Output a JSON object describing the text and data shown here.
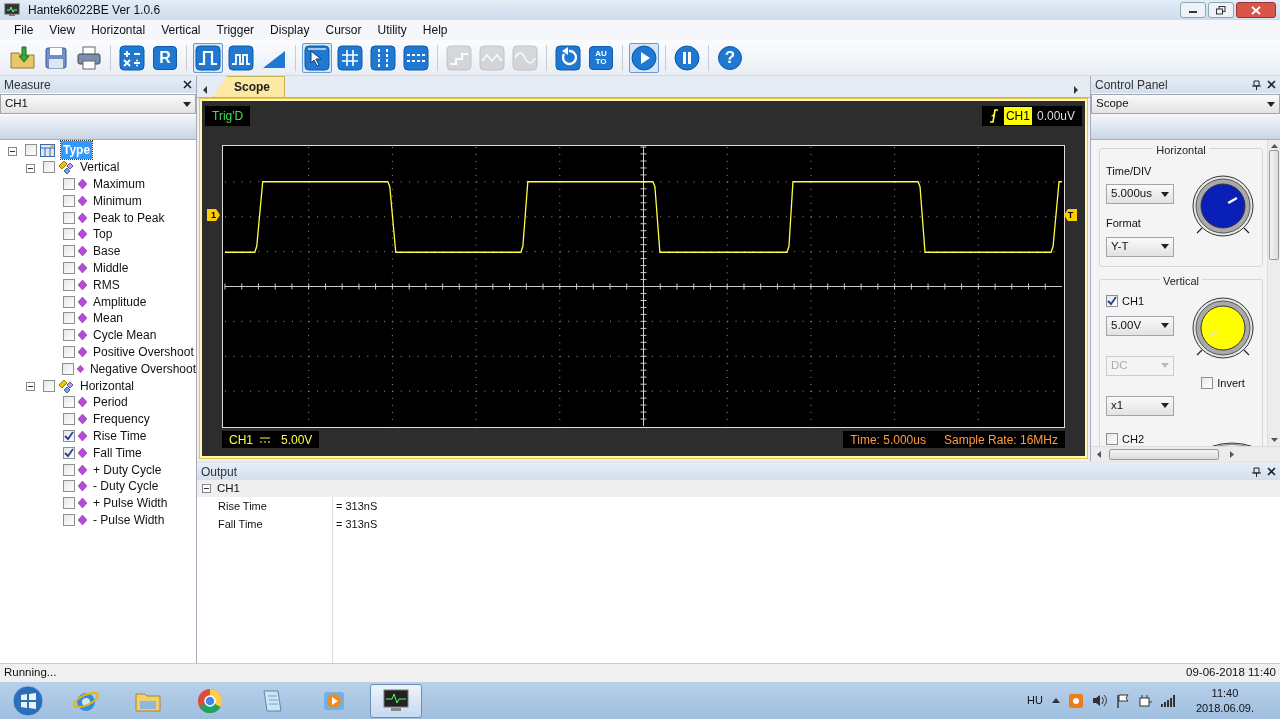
{
  "window": {
    "title": "Hantek6022BE Ver 1.0.6"
  },
  "menu": [
    "File",
    "View",
    "Horizontal",
    "Vertical",
    "Trigger",
    "Display",
    "Cursor",
    "Utility",
    "Help"
  ],
  "toolbar": [
    {
      "kind": "open",
      "selected": false,
      "disabled": false
    },
    {
      "kind": "save",
      "selected": false,
      "disabled": false
    },
    {
      "kind": "print",
      "selected": false,
      "disabled": false
    },
    {
      "kind": "math",
      "selected": false,
      "disabled": false
    },
    {
      "kind": "letter",
      "label": "R",
      "selected": false,
      "disabled": false
    },
    {
      "kind": "square",
      "selected": true,
      "disabled": false
    },
    {
      "kind": "pulse",
      "selected": false,
      "disabled": false
    },
    {
      "kind": "ramp",
      "selected": false,
      "disabled": false
    },
    {
      "kind": "pointer",
      "selected": true,
      "disabled": false
    },
    {
      "kind": "grid",
      "selected": false,
      "disabled": false
    },
    {
      "kind": "vcursor",
      "selected": false,
      "disabled": false
    },
    {
      "kind": "hcursor",
      "selected": false,
      "disabled": false
    },
    {
      "kind": "step",
      "selected": false,
      "disabled": true
    },
    {
      "kind": "triangle",
      "selected": false,
      "disabled": true
    },
    {
      "kind": "sine",
      "selected": false,
      "disabled": true
    },
    {
      "kind": "refresh",
      "selected": false,
      "disabled": false
    },
    {
      "kind": "auto",
      "label": "AU TO",
      "selected": false,
      "disabled": false
    },
    {
      "kind": "play",
      "selected": true,
      "disabled": false
    },
    {
      "kind": "pause",
      "selected": false,
      "disabled": false
    },
    {
      "kind": "help",
      "label": "?",
      "selected": false,
      "disabled": false
    }
  ],
  "measure_panel": {
    "title": "Measure",
    "channel": "CH1",
    "tree": [
      {
        "label": "Type",
        "kind": "root",
        "checked": false,
        "selected": true,
        "expanded": true,
        "children": [
          {
            "label": "Vertical",
            "kind": "group",
            "checked": false,
            "selected": false,
            "expanded": true,
            "children": [
              {
                "label": "Maximum",
                "kind": "item",
                "checked": false,
                "selected": false
              },
              {
                "label": "Minimum",
                "kind": "item",
                "checked": false,
                "selected": false
              },
              {
                "label": "Peak to Peak",
                "kind": "item",
                "checked": false,
                "selected": false
              },
              {
                "label": "Top",
                "kind": "item",
                "checked": false,
                "selected": false
              },
              {
                "label": "Base",
                "kind": "item",
                "checked": false,
                "selected": false
              },
              {
                "label": "Middle",
                "kind": "item",
                "checked": false,
                "selected": false
              },
              {
                "label": "RMS",
                "kind": "item",
                "checked": false,
                "selected": false
              },
              {
                "label": "Amplitude",
                "kind": "item",
                "checked": false,
                "selected": false
              },
              {
                "label": "Mean",
                "kind": "item",
                "checked": false,
                "selected": false
              },
              {
                "label": "Cycle Mean",
                "kind": "item",
                "checked": false,
                "selected": false
              },
              {
                "label": "Positive Overshoot",
                "kind": "item",
                "checked": false,
                "selected": false
              },
              {
                "label": "Negative Overshoot",
                "kind": "item",
                "checked": false,
                "selected": false
              }
            ]
          },
          {
            "label": "Horizontal",
            "kind": "group",
            "checked": false,
            "selected": false,
            "expanded": true,
            "children": [
              {
                "label": "Period",
                "kind": "item",
                "checked": false,
                "selected": false
              },
              {
                "label": "Frequency",
                "kind": "item",
                "checked": false,
                "selected": false
              },
              {
                "label": "Rise Time",
                "kind": "item",
                "checked": true,
                "selected": false
              },
              {
                "label": "Fall Time",
                "kind": "item",
                "checked": true,
                "selected": false
              },
              {
                "label": "+ Duty Cycle",
                "kind": "item",
                "checked": false,
                "selected": false
              },
              {
                "label": "- Duty Cycle",
                "kind": "item",
                "checked": false,
                "selected": false
              },
              {
                "label": "+ Pulse Width",
                "kind": "item",
                "checked": false,
                "selected": false
              },
              {
                "label": "- Pulse Width",
                "kind": "item",
                "checked": false,
                "selected": false
              }
            ]
          }
        ]
      }
    ]
  },
  "scope": {
    "tabs": [
      {
        "label": "Scope",
        "selected": true
      }
    ],
    "status": "Trig'D",
    "trigger_channel": "CH1",
    "trigger_level": "0.00uV",
    "channel_marker": "1",
    "trigger_marker": "T",
    "channel_label": "CH1",
    "volts_div": "5.00V",
    "time": "Time: 5.000us",
    "sample_rate": "Sample Rate: 16MHz"
  },
  "output": {
    "title": "Output",
    "groups": [
      {
        "label": "CH1",
        "expanded": true,
        "rows": [
          {
            "name": "Rise Time",
            "value": "= 313nS"
          },
          {
            "name": "Fall Time",
            "value": "= 313nS"
          }
        ]
      }
    ]
  },
  "control_panel": {
    "title": "Control Panel",
    "mode": "Scope",
    "horizontal": {
      "title": "Horizontal",
      "time_div_label": "Time/DIV",
      "time_div": "5.000us",
      "format_label": "Format",
      "format": "Y-T"
    },
    "vertical": {
      "title": "Vertical",
      "channels": [
        {
          "label": "CH1",
          "checked": true,
          "volts": "5.00V",
          "coupling": "DC",
          "coupling_disabled": true,
          "probe": "x1",
          "invert_label": "Invert",
          "invert": false
        },
        {
          "label": "CH2",
          "checked": false
        }
      ]
    }
  },
  "status_bar": {
    "message": "Running...",
    "datetime": "09-06-2018 11:40"
  },
  "taskbar": {
    "items": [
      {
        "kind": "browser",
        "selected": false
      },
      {
        "kind": "folder",
        "selected": false
      },
      {
        "kind": "circle",
        "selected": false
      },
      {
        "kind": "notepad",
        "selected": false
      },
      {
        "kind": "media",
        "selected": false
      },
      {
        "kind": "scope",
        "selected": true
      }
    ],
    "language": "HU",
    "time": "11:40",
    "date": "2018.06.09."
  }
}
